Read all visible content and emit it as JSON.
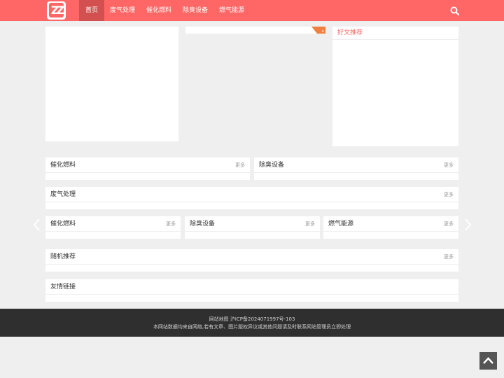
{
  "header": {
    "logo_text": "ZZ",
    "nav": [
      {
        "label": "首页",
        "active": true
      },
      {
        "label": "废气处理",
        "active": false
      },
      {
        "label": "催化燃料",
        "active": false
      },
      {
        "label": "除臭设备",
        "active": false
      },
      {
        "label": "燃气能源",
        "active": false
      }
    ],
    "search_icon": "search-icon"
  },
  "colors": {
    "accent": "#ff6666",
    "accent_dark": "#d35050",
    "footer_bg": "#2f2f2f"
  },
  "recommend": {
    "title": "好文推荐"
  },
  "sections": {
    "row1": [
      {
        "title": "催化燃料",
        "more": "更多"
      },
      {
        "title": "除臭设备",
        "more": "更多"
      }
    ],
    "row2": [
      {
        "title": "废气处理",
        "more": "更多"
      }
    ],
    "row3": [
      {
        "title": "催化燃料",
        "more": "更多"
      },
      {
        "title": "除臭设备",
        "more": "更多"
      },
      {
        "title": "燃气能源",
        "more": "更多"
      }
    ],
    "random": {
      "title": "随机推荐",
      "more": "更多"
    },
    "links": {
      "title": "友情链接"
    }
  },
  "footer": {
    "sitemap": "网站地图",
    "icp": "沪ICP备2024071997号-103",
    "disclaimer": "本网站数据均来自网络,若有文章、图片版权异议或其他问题请及时联系网站管理员立即处理"
  }
}
